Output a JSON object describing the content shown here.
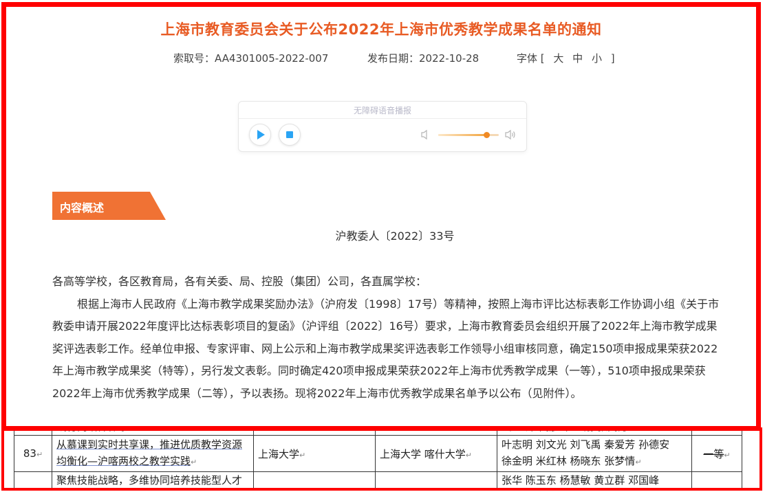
{
  "article": {
    "title": "上海市教育委员会关于公布2022年上海市优秀教学成果名单的通知",
    "index_label": "索取号：",
    "index_value": "AA4301005-2022-007",
    "date_label": "发布日期：",
    "date_value": "2022-10-28",
    "font_label": "字体",
    "font_sizes": "[ 大 中 小 ]"
  },
  "player": {
    "title": "无障碍语音播报",
    "volume": 0.8
  },
  "section_tag": "内容概述",
  "document": {
    "doc_number": "沪教委人〔2022〕33号",
    "salutation": "各高等学校，各区教育局，各有关委、局、控股（集团）公司，各直属学校：",
    "paragraph": "根据上海市人民政府《上海市教学成果奖励办法》（沪府发〔1998〕17号）等精神，按照上海市评比达标表彰工作协调小组《关于市教委申请开展2022年度评比达标表彰项目的复函》（沪评组〔2022〕16号）要求，上海市教育委员会组织开展了2022年上海市教学成果奖评选表彰工作。经单位申报、专家评审、网上公示和上海市教学成果奖评选表彰工作领导小组审核同意，确定150项申报成果荣获2022年上海市教学成果奖（特等），另行发文表彰。同时确定420项申报成果荣获2022年上海市优秀教学成果（一等），510项申报成果荣获2022年上海市优秀教学成果（二等），予以表扬。现将2022年上海市优秀教学成果名单予以公布（见附件）。"
  },
  "table": {
    "partial_top": {
      "title": "践行两培养体系",
      "people": "云  王萍  高彦峰  王刚  张闯芳"
    },
    "row": {
      "no": "83",
      "title_a": "从慕课到实时共享课，推进优质教学资源",
      "title_b": "均衡化—沪喀两校之教学实践",
      "unit": "上海大学",
      "coop": "上海大学  喀什大学",
      "people_a": "叶志明  刘文光  刘飞禹  秦爱芳  孙德安",
      "people_b": "徐金明  米红林  杨晓东  张梦情",
      "level": "一等"
    },
    "partial_bottom": {
      "title": "聚焦技能战略，多维协同培养技能型人才",
      "people": "张华  陈玉东  杨慧敏  黄立群  邓国峰"
    },
    "return_mark": "↵"
  }
}
